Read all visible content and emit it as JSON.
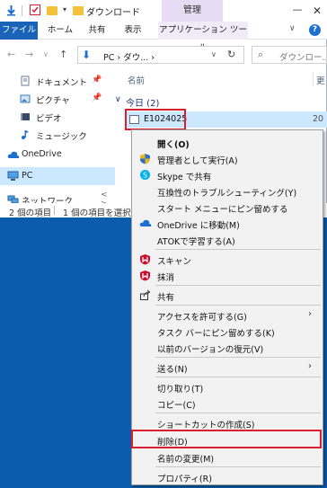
{
  "window": {
    "title": "ダウンロード",
    "context_tab_header": "管理",
    "minimize": "—",
    "close": "✕"
  },
  "ribbon": {
    "tabs": [
      "ファイル",
      "ホーム",
      "共有",
      "表示",
      "アプリケーション ツール"
    ],
    "expand": "∨",
    "help": "?"
  },
  "address": {
    "path": "PC › ダウ... ›",
    "dropdown": "∨",
    "refresh": "↻",
    "search_placeholder": "ダウンロー..."
  },
  "nav_buttons": {
    "back": "←",
    "forward": "→",
    "recent": "∨",
    "up": "↑"
  },
  "sidebar": {
    "items": [
      {
        "label": "ドキュメント",
        "pinned": true
      },
      {
        "label": "ピクチャ",
        "pinned": true
      },
      {
        "label": "ビデオ",
        "pinned": false
      },
      {
        "label": "ミュージック",
        "pinned": false
      },
      {
        "label": "OneDrive",
        "pinned": false
      },
      {
        "label": "PC",
        "pinned": false
      },
      {
        "label": "ネットワーク",
        "pinned": false
      }
    ],
    "pin_glyph": "📌",
    "hscroll": "<  >"
  },
  "files": {
    "column_name": "名前",
    "column_date": "更",
    "group_label": "今日 (2)",
    "group_chevron": "∨",
    "selected_file_name": "E1024025",
    "selected_file_date": "20"
  },
  "status": {
    "count": "2 個の項目",
    "selection": "1 個の項目を選択"
  },
  "context_menu": {
    "open": "開く(O)",
    "run_as_admin": "管理者として実行(A)",
    "skype_share": "Skype で共有",
    "troubleshoot": "互換性のトラブルシューティング(Y)",
    "pin_start": "スタート メニューにピン留めする",
    "onedrive_move": "OneDrive に移動(M)",
    "atok_learn": "ATOKで学習する(A)",
    "scan": "スキャン",
    "shred": "抹消",
    "share": "共有",
    "grant_access": "アクセスを許可する(G)",
    "pin_taskbar": "タスク バーにピン留めする(K)",
    "restore_versions": "以前のバージョンの復元(V)",
    "send_to": "送る(N)",
    "cut": "切り取り(T)",
    "copy": "コピー(C)",
    "create_shortcut": "ショートカットの作成(S)",
    "delete": "削除(D)",
    "rename": "名前の変更(M)",
    "properties": "プロパティ(R)",
    "submenu_arrow": "›"
  },
  "colors": {
    "accent": "#1a64b8",
    "selection": "#cce8ff",
    "highlight_border": "#d9202c",
    "desktop": "#0b5cad",
    "menu_bg": "#f2f2f2",
    "mcafee_red": "#c8102e"
  }
}
